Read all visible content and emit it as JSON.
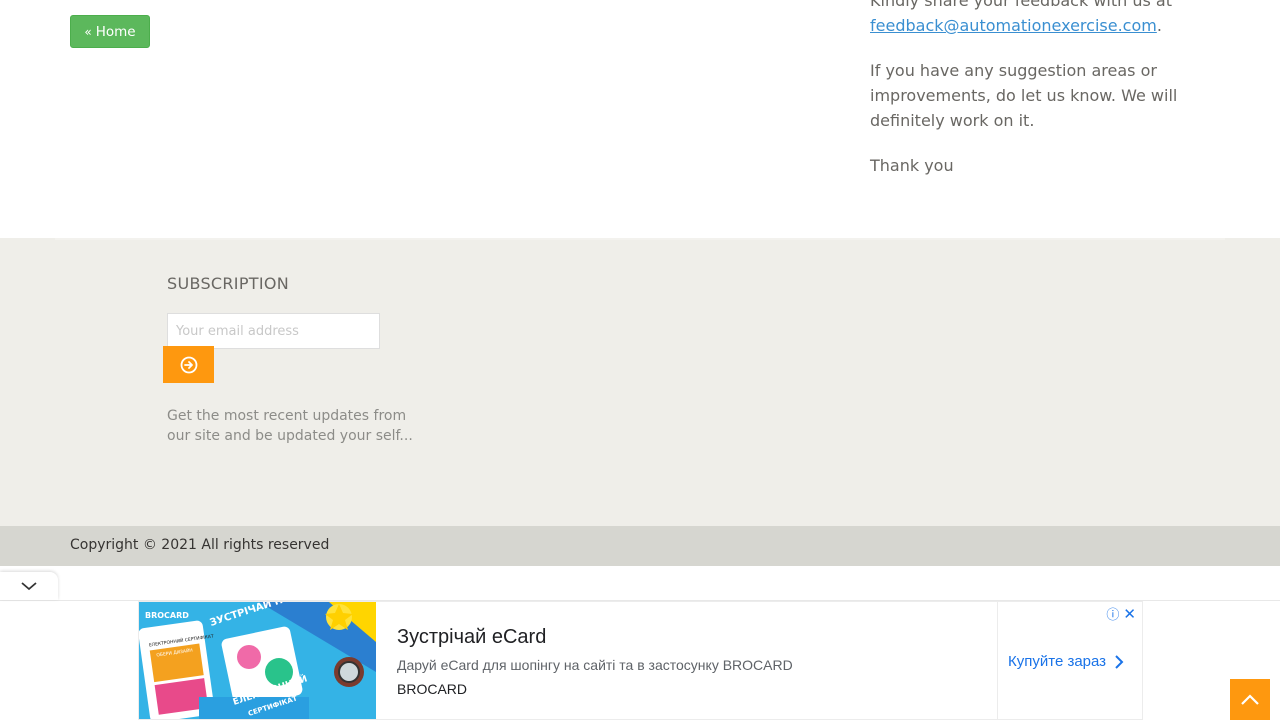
{
  "nav": {
    "home_label": "Home"
  },
  "feedback": {
    "line1_prefix": "Kindly share your feedback with us at",
    "email": "feedback@automationexercise.com",
    "line1_suffix": ".",
    "suggestion": "If you have any suggestion areas or improvements, do let us know. We will definitely work on it.",
    "thanks": "Thank you"
  },
  "subscription": {
    "title": "SUBSCRIPTION",
    "placeholder": "Your email address",
    "note": "Get the most recent updates from our site and be updated your self..."
  },
  "footer": {
    "copyright": "Copyright © 2021 All rights reserved"
  },
  "ad": {
    "title": "Зустрічай eCard",
    "description": "Даруй eCard для шопінгу на сайті та в застосунку BROCARD",
    "brand": "BROCARD",
    "cta": "Купуйте зараз",
    "image_texts": {
      "brand": "BROCARD",
      "headline": "ЗУСТРІЧАЙ НОВИНКУ!",
      "card_label": "ЕЛЕКТРОННИЙ СЕРТИФІКАТ",
      "card_sub": "ОБЕРИ ДИЗАЙН",
      "bottom": "ЕЛЕКТРОННИЙ",
      "bottom2": "СЕРТИФІКАТ"
    }
  },
  "colors": {
    "accent": "#fe980f",
    "home_button": "#5cb85c",
    "link": "#3a8fd1",
    "footer_bg": "#efeee9",
    "copyright_bg": "#d6d6d0"
  },
  "icons": {
    "home": "angle-double-left-icon",
    "subscribe": "arrow-circle-right-icon",
    "collapse": "chevron-down-icon",
    "scroll_top": "angle-up-icon",
    "ad_info": "info-icon",
    "ad_close": "close-icon",
    "ad_cta": "chevron-right-icon"
  }
}
